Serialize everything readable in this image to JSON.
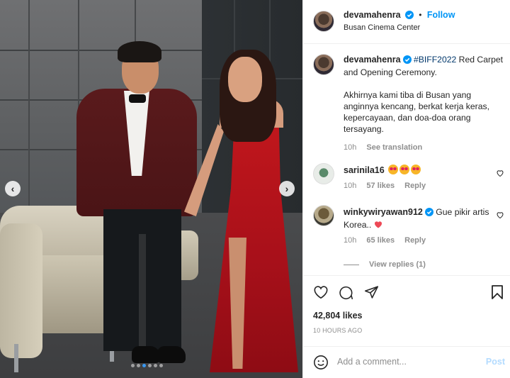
{
  "header": {
    "username": "devamahenra",
    "separator": "•",
    "follow_label": "Follow",
    "location": "Busan Cinema Center"
  },
  "caption": {
    "username": "devamahenra",
    "hashtag": "#BIFF2022",
    "text_1": " Red Carpet and Opening Ceremony.",
    "text_2": "Akhirnya kami tiba di Busan yang anginnya kencang, berkat kerja keras, kepercayaan, dan doa-doa orang tersayang.",
    "time": "10h",
    "see_translation": "See translation"
  },
  "comments": [
    {
      "username": "sarinila16",
      "text": "",
      "emoji_count": 3,
      "time": "10h",
      "likes": "57 likes",
      "reply": "Reply"
    },
    {
      "username": "winkywiryawan912",
      "text": "Gue pikir artis Korea..",
      "time": "10h",
      "likes": "65 likes",
      "reply": "Reply",
      "view_replies": "View replies (1)"
    }
  ],
  "stats": {
    "likes": "42,804 likes",
    "posted": "10 HOURS AGO"
  },
  "composer": {
    "placeholder": "Add a comment...",
    "post_label": "Post"
  },
  "carousel": {
    "slides": 6,
    "active_index": 2
  },
  "colors": {
    "verified": "#0095f6",
    "link": "#0095f6",
    "heart_red": "#ed4956"
  },
  "icons": [
    "heart-icon",
    "comment-icon",
    "share-icon",
    "bookmark-icon",
    "emoji-icon",
    "chevron-left-icon",
    "chevron-right-icon",
    "verified-icon"
  ]
}
